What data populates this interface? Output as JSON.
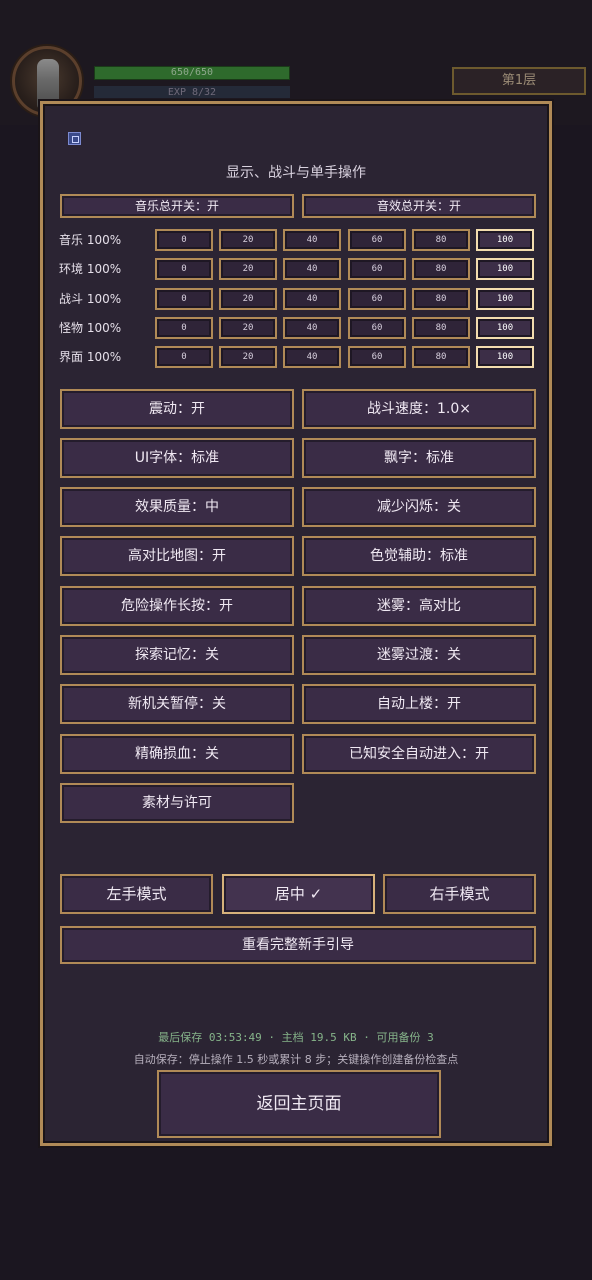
{
  "hud": {
    "hp_text": "650/650",
    "exp_text": "EXP 8/32",
    "floor": "第1层",
    "hp_fill": 1.0
  },
  "dialog": {
    "title": "显示、战斗与单手操作",
    "master": {
      "music": "音乐总开关：开",
      "sfx": "音效总开关：开"
    },
    "volumes": [
      {
        "label": "音乐 100%",
        "selected": "100"
      },
      {
        "label": "环境 100%",
        "selected": "100"
      },
      {
        "label": "战斗 100%",
        "selected": "100"
      },
      {
        "label": "怪物 100%",
        "selected": "100"
      },
      {
        "label": "界面 100%",
        "selected": "100"
      }
    ],
    "volume_options": [
      "0",
      "20",
      "40",
      "60",
      "80",
      "100"
    ],
    "settings": {
      "vibration": "震动：开",
      "battle_speed": "战斗速度：1.0×",
      "ui_font": "UI字体：标准",
      "floating_text": "飘字：标准",
      "effect_quality": "效果质量：中",
      "reduce_flash": "减少闪烁：关",
      "high_contrast_map": "高对比地图：开",
      "color_assist": "色觉辅助：标准",
      "danger_long_press": "危险操作长按：开",
      "fog": "迷雾：高对比",
      "explore_memory": "探索记忆：关",
      "fog_transition": "迷雾过渡：关",
      "new_mechanic_pause": "新机关暂停：关",
      "auto_upstairs": "自动上楼：开",
      "precise_hp_loss": "精确损血：关",
      "known_safe_auto_enter": "已知安全自动进入：开",
      "assets_license": "素材与许可"
    },
    "hand_mode": {
      "left": "左手模式",
      "center": "居中 ✓",
      "right": "右手模式",
      "selected": "center"
    },
    "tutorial_button": "重看完整新手引导",
    "save_info": "最后保存 03:53:49 · 主档 19.5 KB · 可用备份 3",
    "autosave_info": "自动保存：停止操作 1.5 秒或累计 8 步；关键操作创建备份检查点",
    "return_button": "返回主页面"
  },
  "colors": {
    "panel_bg": "#2b2433",
    "border_gold": "#b08a57",
    "active_border": "#f2dcae",
    "save_info_green": "#86b48a"
  }
}
